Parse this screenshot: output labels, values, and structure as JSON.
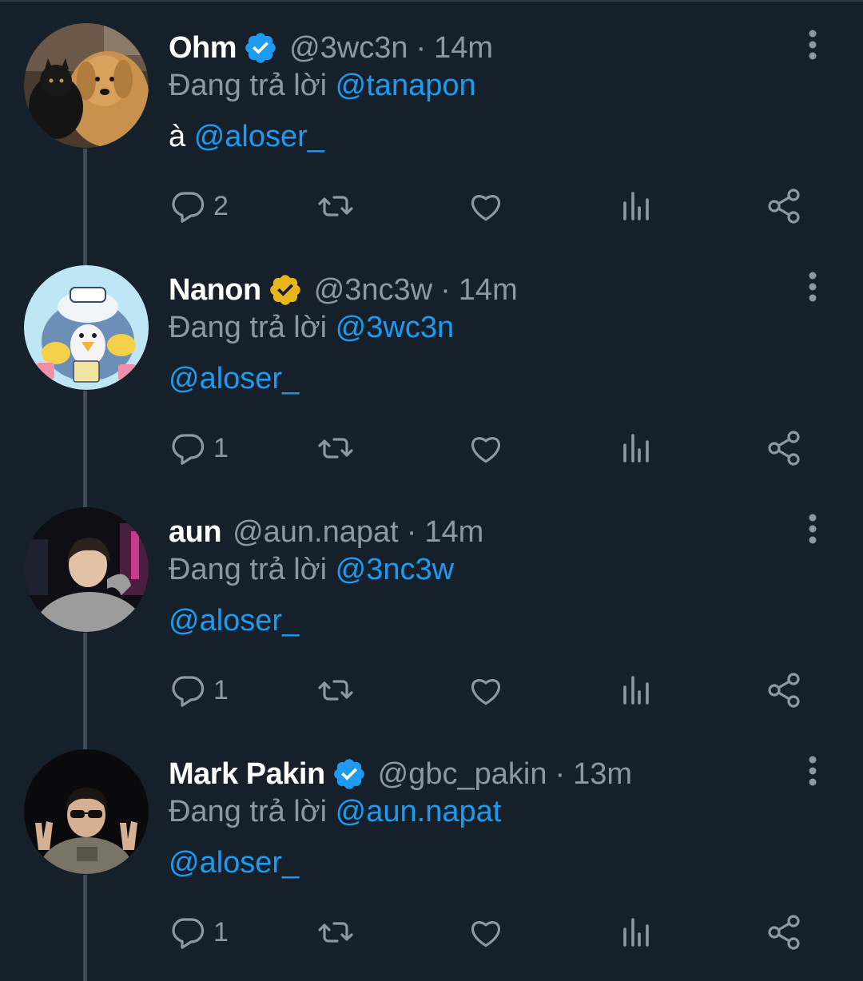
{
  "colors": {
    "background": "#15202b",
    "link": "#1d9bf0",
    "muted": "#8b98a5",
    "verified_blue": "#1d9bf0",
    "verified_gold": "#e8b51b"
  },
  "replying_prefix": "Đang trả lời",
  "tweets": [
    {
      "name": "Ohm",
      "verified": "blue",
      "handle": "@3wc3n",
      "dot": "·",
      "time": "14m",
      "replying_to": "@tanapon",
      "body_prefix": "à ",
      "body_mention": "@aloser_",
      "reply_count": "2",
      "avatar_icon": "dog-and-cat-photo"
    },
    {
      "name": "Nanon",
      "verified": "gold",
      "handle": "@3nc3w",
      "dot": "·",
      "time": "14m",
      "replying_to": "@3wc3n",
      "body_prefix": "",
      "body_mention": "@aloser_",
      "reply_count": "1",
      "avatar_icon": "penguin-cartoon"
    },
    {
      "name": "aun",
      "verified": "none",
      "handle": "@aun.napat",
      "dot": "·",
      "time": "14m",
      "replying_to": "@3nc3w",
      "body_prefix": "",
      "body_mention": "@aloser_",
      "reply_count": "1",
      "avatar_icon": "person-photo"
    },
    {
      "name": "Mark Pakin",
      "verified": "blue",
      "handle": "@gbc_pakin",
      "dot": "·",
      "time": "13m",
      "replying_to": "@aun.napat",
      "body_prefix": "",
      "body_mention": "@aloser_",
      "reply_count": "1",
      "avatar_icon": "person-peace-sign-photo"
    }
  ]
}
